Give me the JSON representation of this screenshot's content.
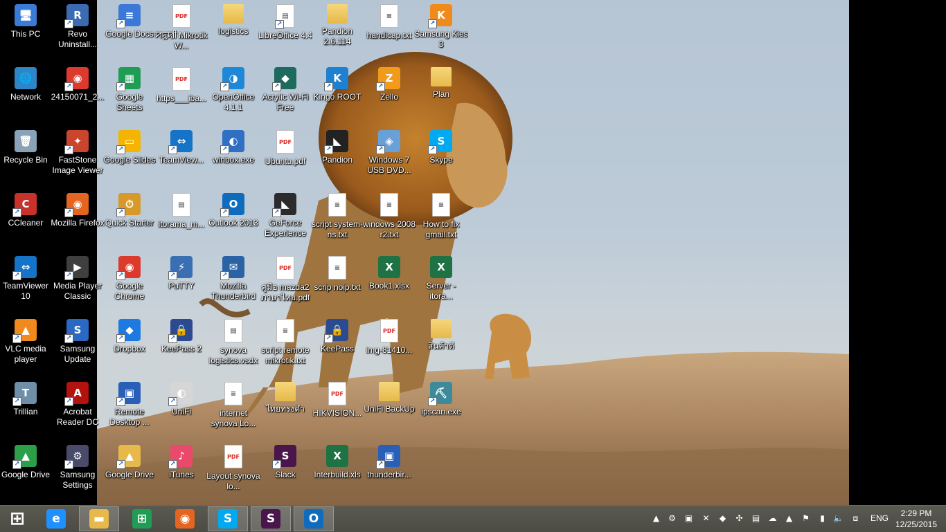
{
  "desktop": {
    "icons": [
      {
        "label": "This PC",
        "icon": "computer-icon",
        "color": "#3a7bd5",
        "glyph": "🖥"
      },
      {
        "label": "Network",
        "icon": "network-icon",
        "color": "#2f86c7",
        "glyph": "🌐"
      },
      {
        "label": "Recycle Bin",
        "icon": "recycle-bin-icon",
        "color": "#8aa2b8",
        "glyph": "🗑"
      },
      {
        "label": "CCleaner",
        "icon": "ccleaner-icon",
        "color": "#c8322a",
        "glyph": "C"
      },
      {
        "label": "TeamViewer 10",
        "icon": "teamviewer-icon",
        "color": "#1574c7",
        "glyph": "⇔"
      },
      {
        "label": "VLC media player",
        "icon": "vlc-icon",
        "color": "#f08a1c",
        "glyph": "▲"
      },
      {
        "label": "Trillian",
        "icon": "trillian-icon",
        "color": "#6f8fa8",
        "glyph": "T"
      },
      {
        "label": "Google Drive",
        "icon": "google-drive-icon",
        "color": "#2d9f49",
        "glyph": "▲"
      },
      {
        "label": "Revo Uninstall...",
        "icon": "revo-uninstaller-icon",
        "color": "#3b6bb1",
        "glyph": "R"
      },
      {
        "label": "24150071_2...",
        "icon": "chrome-icon",
        "color": "#db3a2d",
        "glyph": "◉"
      },
      {
        "label": "FastStone Image Viewer",
        "icon": "faststone-icon",
        "color": "#c9452d",
        "glyph": "✦"
      },
      {
        "label": "Mozilla Firefox",
        "icon": "firefox-icon",
        "color": "#e4651f",
        "glyph": "◉"
      },
      {
        "label": "Media Player Classic",
        "icon": "media-player-icon",
        "color": "#3f3f3f",
        "glyph": "▶"
      },
      {
        "label": "Samsung Update",
        "icon": "samsung-update-icon",
        "color": "#2a68c4",
        "glyph": "S"
      },
      {
        "label": "Acrobat Reader DC",
        "icon": "acrobat-icon",
        "color": "#b3130f",
        "glyph": "A"
      },
      {
        "label": "Samsung Settings",
        "icon": "samsung-settings-icon",
        "color": "#4a4a6a",
        "glyph": "⚙"
      },
      {
        "label": "Google Docs",
        "icon": "google-docs-icon",
        "color": "#3c78d8",
        "glyph": "≡"
      },
      {
        "label": "Google Sheets",
        "icon": "google-sheets-icon",
        "color": "#1f9d55",
        "glyph": "▦"
      },
      {
        "label": "Google Slides",
        "icon": "google-slides-icon",
        "color": "#f4b400",
        "glyph": "▭"
      },
      {
        "label": "Quick Starter",
        "icon": "quick-starter-icon",
        "color": "#d79a2a",
        "glyph": "⏱"
      },
      {
        "label": "Google Chrome",
        "icon": "chrome-icon",
        "color": "#db3a2d",
        "glyph": "◉"
      },
      {
        "label": "Dropbox",
        "icon": "dropbox-icon",
        "color": "#1e7ae0",
        "glyph": "◆"
      },
      {
        "label": "Remote Desktop ...",
        "icon": "remote-desktop-icon",
        "color": "#2a5fb8",
        "glyph": "▣"
      },
      {
        "label": "Google Drive",
        "icon": "google-drive-folder-icon",
        "color": "#e6b94a",
        "glyph": "▲"
      },
      {
        "label": "ꠙꠍꠢꠤ Mikrotik W...",
        "icon": "pdf-icon",
        "color": "#d9251d",
        "glyph": "PDF"
      },
      {
        "label": "https___iba...",
        "icon": "pdf-icon",
        "color": "#d9251d",
        "glyph": "PDF"
      },
      {
        "label": "TeamView...",
        "icon": "teamviewer-icon",
        "color": "#1574c7",
        "glyph": "⇔"
      },
      {
        "label": "itorama_m...",
        "icon": "image-file-icon",
        "color": "#cfe3e8",
        "glyph": "▤"
      },
      {
        "label": "PuTTY",
        "icon": "putty-icon",
        "color": "#3a6fb3",
        "glyph": "⚡"
      },
      {
        "label": "KeePass 2",
        "icon": "keepass-icon",
        "color": "#2b4a8f",
        "glyph": "🔒"
      },
      {
        "label": "UniFi",
        "icon": "unifi-icon",
        "color": "#d6d6d6",
        "glyph": "◐"
      },
      {
        "label": "iTunes",
        "icon": "itunes-icon",
        "color": "#e94a6c",
        "glyph": "♪"
      },
      {
        "label": "logistics",
        "icon": "folder-icon",
        "color": "#e6b94a",
        "glyph": ""
      },
      {
        "label": "OpenOffice 4.1.1",
        "icon": "openoffice-icon",
        "color": "#1e88d8",
        "glyph": "◑"
      },
      {
        "label": "winbox.exe",
        "icon": "winbox-icon",
        "color": "#2f6fc4",
        "glyph": "◐"
      },
      {
        "label": "Outlook 2013",
        "icon": "outlook-icon",
        "color": "#0f6cbd",
        "glyph": "O"
      },
      {
        "label": "Mozilla Thunderbird",
        "icon": "thunderbird-icon",
        "color": "#2a62a6",
        "glyph": "✉"
      },
      {
        "label": "synova logistics.vsdx",
        "icon": "visio-file-icon",
        "color": "#ffffff",
        "glyph": "▤"
      },
      {
        "label": "internet synova Lo...",
        "icon": "text-file-icon",
        "color": "#ffffff",
        "glyph": "≡"
      },
      {
        "label": "Layout synova lo...",
        "icon": "pdf-icon",
        "color": "#d9251d",
        "glyph": "PDF"
      },
      {
        "label": "LibreOffice 4.4",
        "icon": "libreoffice-icon",
        "color": "#ffffff",
        "glyph": "▤"
      },
      {
        "label": "Acrylic Wi-Fi Free",
        "icon": "acrylic-wifi-icon",
        "color": "#1d6b5e",
        "glyph": "◆"
      },
      {
        "label": "Ubuntu.pdf",
        "icon": "pdf-icon",
        "color": "#d9251d",
        "glyph": "PDF"
      },
      {
        "label": "GeForce Experience",
        "icon": "geforce-icon",
        "color": "#2b2b2b",
        "glyph": "◣"
      },
      {
        "label": "คู่มือ mazda2 ภาษาไทย.pdf",
        "icon": "pdf-icon",
        "color": "#d9251d",
        "glyph": "PDF"
      },
      {
        "label": "script remote mikrotik.txt",
        "icon": "text-file-icon",
        "color": "#ffffff",
        "glyph": "≡"
      },
      {
        "label": "ไทยทรงดำ",
        "icon": "folder-icon",
        "color": "#e6b94a",
        "glyph": ""
      },
      {
        "label": "Slack",
        "icon": "slack-icon",
        "color": "#4a154b",
        "glyph": "S"
      },
      {
        "label": "Pandion 2.6.114",
        "icon": "folder-icon",
        "color": "#e6b94a",
        "glyph": ""
      },
      {
        "label": "Kingo ROOT",
        "icon": "kingo-root-icon",
        "color": "#1e80d0",
        "glyph": "K"
      },
      {
        "label": "Pandion",
        "icon": "pandion-icon",
        "color": "#222222",
        "glyph": "◣"
      },
      {
        "label": "script system-ns.txt",
        "icon": "text-file-icon",
        "color": "#ffffff",
        "glyph": "≡"
      },
      {
        "label": "scrip noip.txt",
        "icon": "text-file-icon",
        "color": "#ffffff",
        "glyph": "≡"
      },
      {
        "label": "KeePass",
        "icon": "keepass-icon",
        "color": "#2b4a8f",
        "glyph": "🔒"
      },
      {
        "label": "HIKVISION...",
        "icon": "pdf-icon",
        "color": "#d9251d",
        "glyph": "PDF"
      },
      {
        "label": "Interbuild.xls",
        "icon": "excel-file-icon",
        "color": "#1f7244",
        "glyph": "X"
      },
      {
        "label": "handicap.txt",
        "icon": "text-file-icon",
        "color": "#ffffff",
        "glyph": "≡"
      },
      {
        "label": "Zello",
        "icon": "zello-icon",
        "color": "#f29a1a",
        "glyph": "Z"
      },
      {
        "label": "Windows 7 USB DVD...",
        "icon": "windows-usb-tool-icon",
        "color": "#6aa0d8",
        "glyph": "◈"
      },
      {
        "label": "windows 2008 r2.txt",
        "icon": "text-file-icon",
        "color": "#ffffff",
        "glyph": "≡"
      },
      {
        "label": "Book1.xlsx",
        "icon": "excel-file-icon",
        "color": "#1f7244",
        "glyph": "X"
      },
      {
        "label": "img-81410...",
        "icon": "pdf-icon",
        "color": "#d9251d",
        "glyph": "PDF"
      },
      {
        "label": "UniFi BackUp",
        "icon": "folder-icon",
        "color": "#e6b94a",
        "glyph": ""
      },
      {
        "label": "thunderbir...",
        "icon": "remote-desktop-icon",
        "color": "#2a5fb8",
        "glyph": "▣"
      },
      {
        "label": "Samsung Kies 3",
        "icon": "samsung-kies-icon",
        "color": "#f08a1c",
        "glyph": "K"
      },
      {
        "label": "Plan",
        "icon": "folder-icon",
        "color": "#e6b94a",
        "glyph": ""
      },
      {
        "label": "Skype",
        "icon": "skype-icon",
        "color": "#00a9f0",
        "glyph": "S"
      },
      {
        "label": "How to fix gmail.txt",
        "icon": "text-file-icon",
        "color": "#ffffff",
        "glyph": "≡"
      },
      {
        "label": "Server - itora...",
        "icon": "excel-file-icon",
        "color": "#1f7244",
        "glyph": "X"
      },
      {
        "label": "สินค้าดี",
        "icon": "folder-icon",
        "color": "#e6b94a",
        "glyph": ""
      },
      {
        "label": "ipscan.exe",
        "icon": "ipscan-icon",
        "color": "#3c8a9a",
        "glyph": "⛏"
      }
    ]
  },
  "taskbar": {
    "items": [
      {
        "name": "start-button",
        "icon": "windows-logo-icon",
        "color": "#ffffff",
        "glyph": "⊞",
        "active": false
      },
      {
        "name": "internet-explorer-button",
        "icon": "internet-explorer-icon",
        "color": "#1e90ff",
        "glyph": "e",
        "active": false
      },
      {
        "name": "file-explorer-button",
        "icon": "file-explorer-icon",
        "color": "#e6b94a",
        "glyph": "▬",
        "active": true
      },
      {
        "name": "store-button",
        "icon": "store-icon",
        "color": "#1f9d55",
        "glyph": "⊞",
        "active": false
      },
      {
        "name": "firefox-button",
        "icon": "firefox-icon",
        "color": "#e4651f",
        "glyph": "◉",
        "active": false
      },
      {
        "name": "skype-button",
        "icon": "skype-icon",
        "color": "#00a9f0",
        "glyph": "S",
        "active": true
      },
      {
        "name": "slack-button",
        "icon": "slack-icon",
        "color": "#4a154b",
        "glyph": "S",
        "active": true
      },
      {
        "name": "outlook-button",
        "icon": "outlook-icon",
        "color": "#0f6cbd",
        "glyph": "O",
        "active": true
      }
    ],
    "tray": [
      {
        "name": "show-hidden-icons",
        "icon": "chevron-up-icon",
        "glyph": "▲"
      },
      {
        "name": "tray-settings",
        "icon": "gear-icon",
        "glyph": "⚙"
      },
      {
        "name": "tray-monitor",
        "icon": "monitor-icon",
        "glyph": "▣"
      },
      {
        "name": "tray-no-sync",
        "icon": "sync-error-icon",
        "glyph": "✕"
      },
      {
        "name": "tray-java",
        "icon": "app-icon",
        "glyph": "◆"
      },
      {
        "name": "tray-network-app",
        "icon": "network-app-icon",
        "glyph": "✣"
      },
      {
        "name": "tray-display",
        "icon": "display-icon",
        "glyph": "▤"
      },
      {
        "name": "tray-onedrive",
        "icon": "cloud-icon",
        "glyph": "☁"
      },
      {
        "name": "tray-google-drive",
        "icon": "google-drive-icon",
        "glyph": "▲"
      },
      {
        "name": "tray-action-center",
        "icon": "flag-icon",
        "glyph": "⚑"
      },
      {
        "name": "tray-power",
        "icon": "battery-icon",
        "glyph": "▮"
      },
      {
        "name": "tray-volume",
        "icon": "speaker-icon",
        "glyph": "🔈"
      },
      {
        "name": "tray-network",
        "icon": "network-status-icon",
        "glyph": "⧈"
      }
    ],
    "language": "ENG",
    "time": "2:29 PM",
    "date": "12/25/2015"
  }
}
